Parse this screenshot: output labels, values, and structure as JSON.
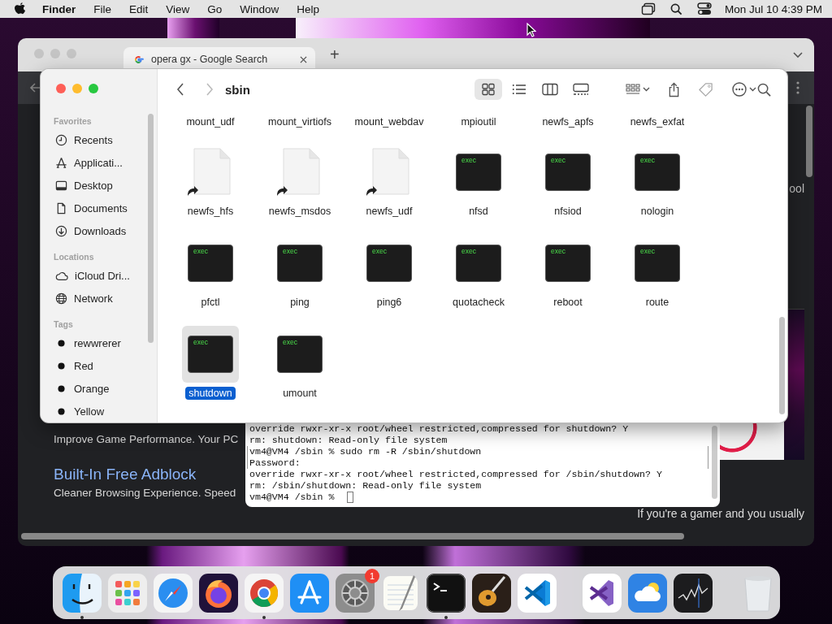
{
  "menu_bar": {
    "app": "Finder",
    "menus": [
      "File",
      "Edit",
      "View",
      "Go",
      "Window",
      "Help"
    ],
    "clock": "Mon Jul 10  4:39 PM"
  },
  "browser": {
    "tab": {
      "title": "opera gx - Google Search"
    },
    "new_tab": "+",
    "content": {
      "fragment": "ool",
      "lines": [
        {
          "kind": "body",
          "text": "Improve Game Performance. Your PC"
        },
        {
          "kind": "heading",
          "text": "Built-In Free Adblock"
        },
        {
          "kind": "body",
          "text": "Cleaner Browsing Experience. Speed"
        }
      ],
      "side_text": "If you're a gamer and you usually"
    }
  },
  "terminal": {
    "lines": [
      {
        "text": "override rwxr-xr-x root/wheel restricted,compressed for shutdown? Y",
        "marked": false
      },
      {
        "text": "rm: shutdown: Read-only file system",
        "marked": false
      },
      {
        "text": "vm4@VM4 /sbin % sudo rm -R /sbin/shutdown",
        "marked": true
      },
      {
        "text": "Password:",
        "marked": true
      },
      {
        "text": "override rwxr-xr-x root/wheel restricted,compressed for /sbin/shutdown? Y",
        "marked": false
      },
      {
        "text": "rm: /sbin/shutdown: Read-only file system",
        "marked": false
      }
    ],
    "prompt": "vm4@VM4 /sbin %"
  },
  "finder": {
    "title": "sbin",
    "view_modes": [
      {
        "kind": "icons",
        "selected": true
      },
      {
        "kind": "list",
        "selected": false
      },
      {
        "kind": "columns",
        "selected": false
      },
      {
        "kind": "gallery",
        "selected": false
      }
    ],
    "sidebar": [
      {
        "heading": "Favorites",
        "items": [
          {
            "label": "Recents"
          },
          {
            "label": "Applicati..."
          },
          {
            "label": "Desktop"
          },
          {
            "label": "Documents"
          },
          {
            "label": "Downloads"
          }
        ]
      },
      {
        "heading": "Locations",
        "items": [
          {
            "label": "iCloud Dri..."
          },
          {
            "label": "Network"
          }
        ]
      },
      {
        "heading": "Tags",
        "items": [
          {
            "label": "rewwrerer"
          },
          {
            "label": "Red"
          },
          {
            "label": "Orange"
          },
          {
            "label": "Yellow"
          }
        ]
      }
    ],
    "files": [
      {
        "name": "mount_udf",
        "kind": "cut",
        "selected": false
      },
      {
        "name": "mount_virtiofs",
        "kind": "cut",
        "selected": false
      },
      {
        "name": "mount_webdav",
        "kind": "cut",
        "selected": false
      },
      {
        "name": "mpioutil",
        "kind": "cut",
        "selected": false
      },
      {
        "name": "newfs_apfs",
        "kind": "cut",
        "selected": false
      },
      {
        "name": "newfs_exfat",
        "kind": "cut",
        "selected": false
      },
      {
        "name": "newfs_hfs",
        "kind": "alias",
        "selected": false
      },
      {
        "name": "newfs_msdos",
        "kind": "alias",
        "selected": false
      },
      {
        "name": "newfs_udf",
        "kind": "alias",
        "selected": false
      },
      {
        "name": "nfsd",
        "kind": "exec",
        "icon_text": "exec",
        "selected": false
      },
      {
        "name": "nfsiod",
        "kind": "exec",
        "icon_text": "exec",
        "selected": false
      },
      {
        "name": "nologin",
        "kind": "exec",
        "icon_text": "exec",
        "selected": false
      },
      {
        "name": "pfctl",
        "kind": "exec",
        "icon_text": "exec",
        "selected": false
      },
      {
        "name": "ping",
        "kind": "exec",
        "icon_text": "exec",
        "selected": false
      },
      {
        "name": "ping6",
        "kind": "exec",
        "icon_text": "exec",
        "selected": false
      },
      {
        "name": "quotacheck",
        "kind": "exec",
        "icon_text": "exec",
        "selected": false
      },
      {
        "name": "reboot",
        "kind": "exec",
        "icon_text": "exec",
        "selected": false
      },
      {
        "name": "route",
        "kind": "exec",
        "icon_text": "exec",
        "selected": false
      },
      {
        "name": "shutdown",
        "kind": "exec",
        "icon_text": "exec",
        "selected": true
      },
      {
        "name": "umount",
        "kind": "exec",
        "icon_text": "exec",
        "selected": false
      }
    ]
  },
  "dock": [
    {
      "kind": "finder",
      "running": true
    },
    {
      "kind": "launchpad",
      "running": false
    },
    {
      "kind": "safari",
      "running": false
    },
    {
      "kind": "firefox",
      "running": false
    },
    {
      "kind": "chrome",
      "running": true
    },
    {
      "kind": "appstore",
      "running": false
    },
    {
      "kind": "settings",
      "running": false,
      "badge": "1"
    },
    {
      "kind": "textedit",
      "running": false
    },
    {
      "kind": "terminal",
      "running": true
    },
    {
      "kind": "garageband",
      "running": false
    },
    {
      "kind": "vscode",
      "running": false
    },
    {
      "kind": "separator"
    },
    {
      "kind": "visualstudio",
      "running": false
    },
    {
      "kind": "weather",
      "running": false
    },
    {
      "kind": "stocks",
      "running": false
    },
    {
      "kind": "separator"
    },
    {
      "kind": "trash",
      "running": false
    }
  ]
}
